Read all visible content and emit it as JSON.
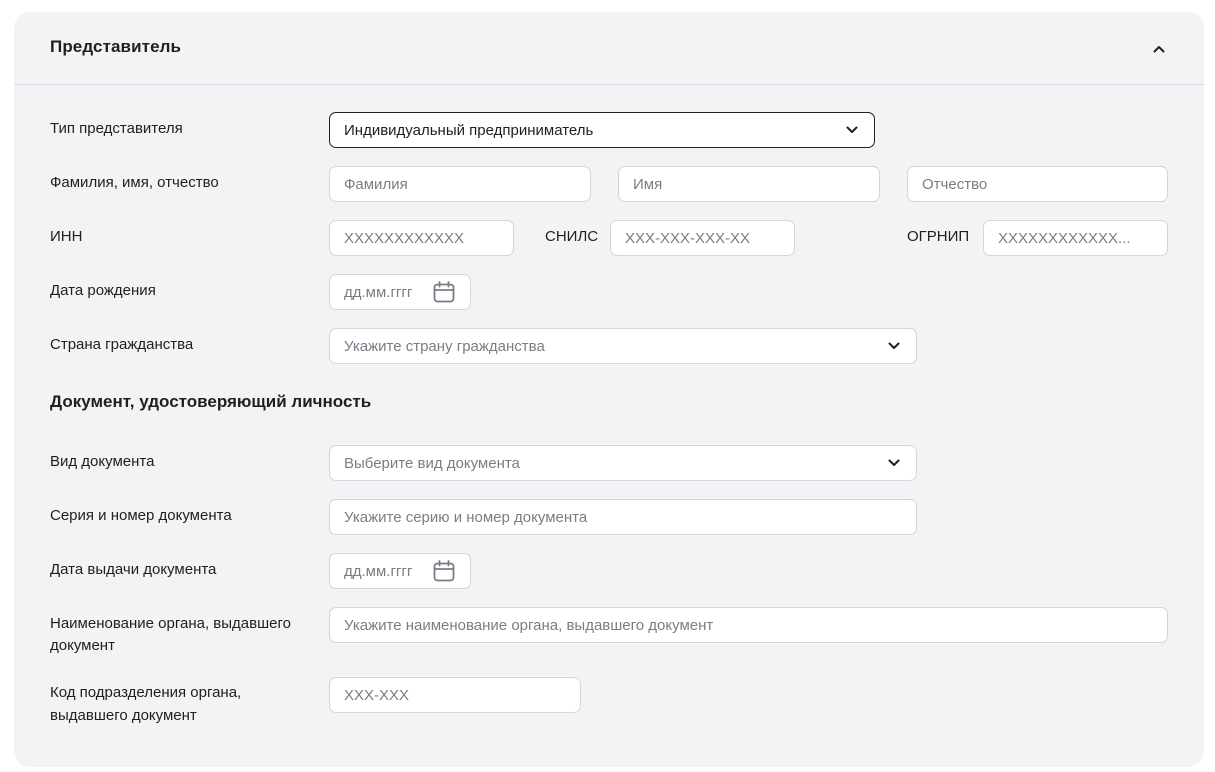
{
  "panel": {
    "title": "Представитель",
    "collapse_icon": "chevron-up-icon"
  },
  "representative": {
    "type": {
      "label": "Тип представителя",
      "value": "Индивидуальный предприниматель",
      "icon": "chevron-down-icon"
    },
    "fio": {
      "label": "Фамилия, имя, отчество",
      "surname_placeholder": "Фамилия",
      "name_placeholder": "Имя",
      "patronymic_placeholder": "Отчество"
    },
    "inn": {
      "label": "ИНН",
      "placeholder": "XXXXXXXXXXXX"
    },
    "snils": {
      "label": "СНИЛС",
      "placeholder": "XXX-XXX-XXX-XX"
    },
    "ogrnip": {
      "label": "ОГРНИП",
      "placeholder": "XXXXXXXXXXXX..."
    },
    "birth_date": {
      "label": "Дата рождения",
      "placeholder": "дд.мм.гггг",
      "icon": "calendar-icon"
    },
    "citizenship": {
      "label": "Страна гражданства",
      "placeholder": "Укажите страну гражданства",
      "icon": "chevron-down-icon"
    }
  },
  "document": {
    "title": "Документ, удостоверяющий личность",
    "kind": {
      "label": "Вид документа",
      "placeholder": "Выберите вид документа",
      "icon": "chevron-down-icon"
    },
    "series_number": {
      "label": "Серия и номер документа",
      "placeholder": "Укажите серию и номер документа"
    },
    "issue_date": {
      "label": "Дата выдачи документа",
      "placeholder": "дд.мм.гггг",
      "icon": "calendar-icon"
    },
    "authority": {
      "label_line1": "Наименование органа, выдавшего",
      "label_line2": "документ",
      "placeholder": "Укажите наименование органа, выдавшего документ"
    },
    "division_code": {
      "label_line1": "Код подразделения органа,",
      "label_line2": "выдавшего документ",
      "placeholder": "XXX-XXX"
    }
  },
  "colors": {
    "panel_bg": "#f2f3f5",
    "border": "#d3d5da",
    "text": "#1f1f22",
    "placeholder": "#7a7d85"
  }
}
